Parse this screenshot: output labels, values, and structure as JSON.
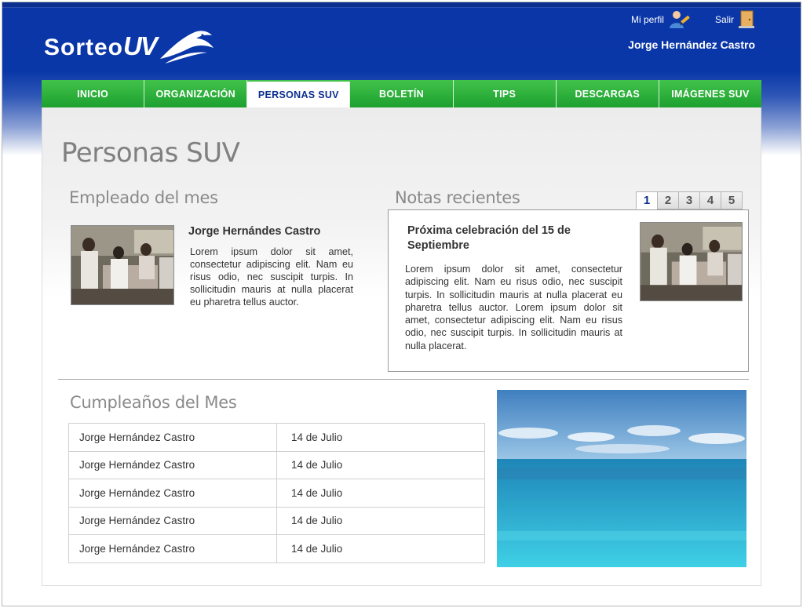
{
  "brand": {
    "logo_text": "Sorteo",
    "logo_accent": "UV"
  },
  "user": {
    "profile_label": "Mi perfil",
    "logout_label": "Salir",
    "name": "Jorge Hernández Castro"
  },
  "nav": {
    "items": [
      {
        "label": "INICIO"
      },
      {
        "label": "ORGANIZACIÓN"
      },
      {
        "label": "PERSONAS SUV"
      },
      {
        "label": "BOLETÍN"
      },
      {
        "label": "TIPS"
      },
      {
        "label": "DESCARGAS"
      },
      {
        "label": "IMÁGENES SUV"
      }
    ],
    "active": "PERSONAS SUV"
  },
  "page": {
    "title": "Personas SUV"
  },
  "employee": {
    "section_title": "Empleado del mes",
    "name": "Jorge Hernándes Castro",
    "text": "Lorem ipsum dolor sit amet, consectetur adipiscing elit. Nam eu risus odio, nec suscipit turpis. In sollicitudin mauris at nulla placerat eu pharetra tellus auctor."
  },
  "notes": {
    "section_title": "Notas recientes",
    "pages": [
      "1",
      "2",
      "3",
      "4",
      "5"
    ],
    "active_page": "1",
    "title": "Próxima celebración del 15 de Septiembre",
    "text": "Lorem ipsum dolor sit amet, consectetur adipiscing elit. Nam eu risus odio, nec suscipit turpis. In sollicitudin mauris at nulla placerat eu pharetra tellus auctor. Lorem ipsum dolor sit amet, consectetur adipiscing elit. Nam eu risus odio, nec suscipit turpis. In sollicitudin mauris at nulla placerat."
  },
  "birthdays": {
    "section_title": "Cumpleaños del Mes",
    "rows": [
      {
        "name": "Jorge Hernández Castro",
        "date": "14 de Julio"
      },
      {
        "name": "Jorge Hernández Castro",
        "date": "14 de Julio"
      },
      {
        "name": "Jorge Hernández Castro",
        "date": "14 de Julio"
      },
      {
        "name": "Jorge Hernández Castro",
        "date": "14 de Julio"
      },
      {
        "name": "Jorge Hernández Castro",
        "date": "14 de Julio"
      }
    ]
  },
  "icons": {
    "profile": "user-edit-icon",
    "logout": "exit-door-icon",
    "logo": "eagle-logo-icon"
  },
  "colors": {
    "header_blue": "#0a37a8",
    "nav_green": "#2db03c",
    "active_nav_text": "#0b2f8f"
  }
}
